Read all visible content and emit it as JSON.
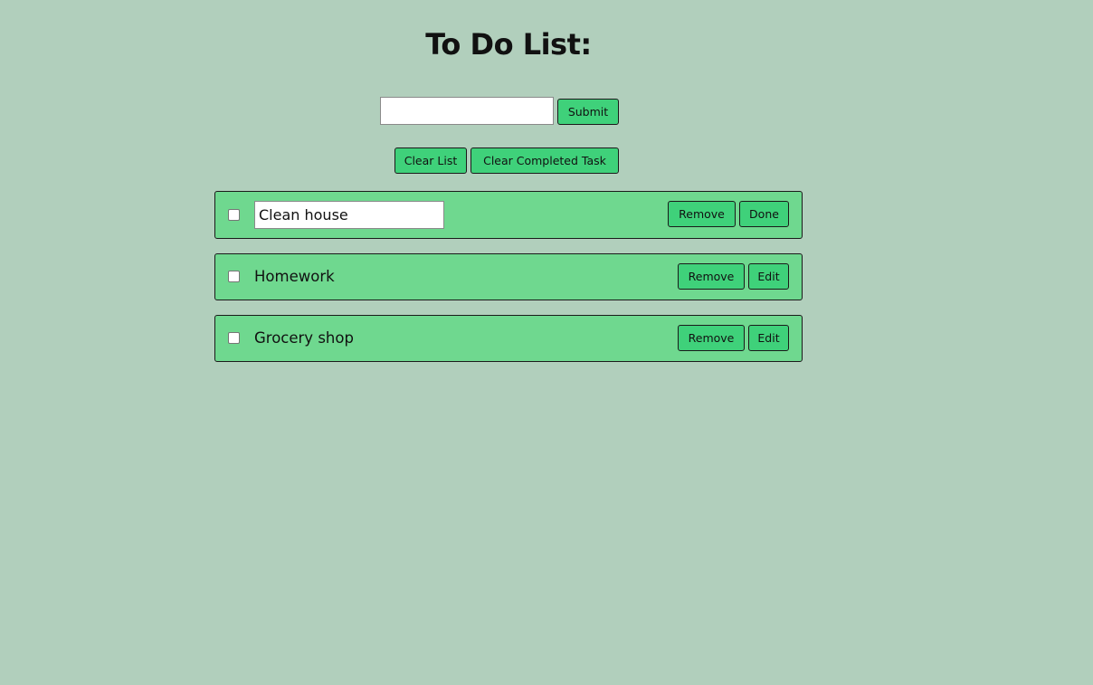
{
  "header": {
    "title": "To Do List:"
  },
  "new_task": {
    "input_value": "",
    "submit_label": "Submit"
  },
  "controls": {
    "clear_list_label": "Clear List",
    "clear_completed_label": "Clear Completed Task"
  },
  "tasks": [
    {
      "text": "Clean house",
      "editing": true,
      "checked": false,
      "remove_label": "Remove",
      "action_label": "Done"
    },
    {
      "text": "Homework",
      "editing": false,
      "checked": false,
      "remove_label": "Remove",
      "action_label": "Edit"
    },
    {
      "text": "Grocery shop",
      "editing": false,
      "checked": false,
      "remove_label": "Remove",
      "action_label": "Edit"
    }
  ],
  "colors": {
    "background": "#b1cfbc",
    "task_background": "#6fd88f",
    "button_background": "#3fd17a",
    "border": "#1a1a1a"
  }
}
